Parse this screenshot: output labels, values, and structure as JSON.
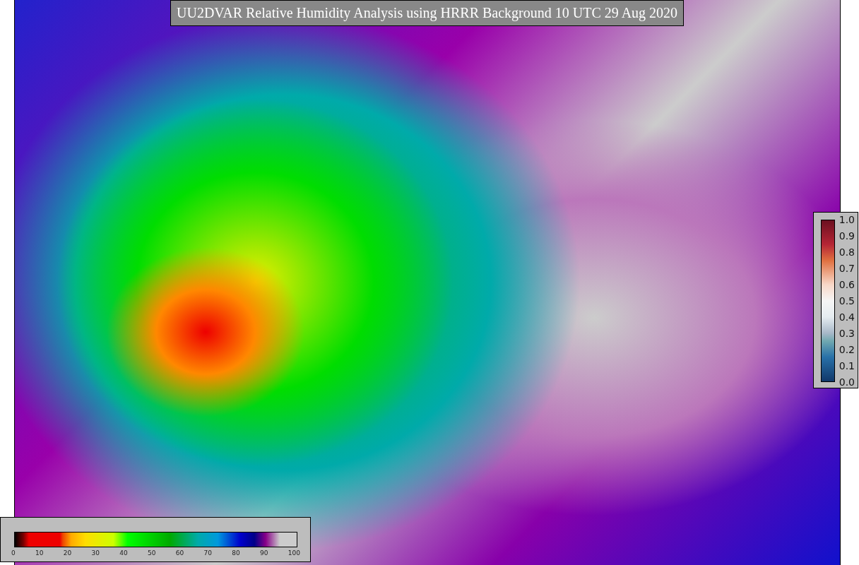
{
  "title": "UU2DVAR Relative Humidity Analysis using HRRR Background 10 UTC 29 Aug 2020",
  "humidity_colorbar": {
    "ticks": [
      "0",
      "10",
      "20",
      "30",
      "40",
      "50",
      "60",
      "70",
      "80",
      "90",
      "100"
    ]
  },
  "observation_colorbar": {
    "ticks": [
      "1.0",
      "0.9",
      "0.8",
      "0.7",
      "0.6",
      "0.5",
      "0.4",
      "0.3",
      "0.2",
      "0.1",
      "0.0"
    ]
  }
}
